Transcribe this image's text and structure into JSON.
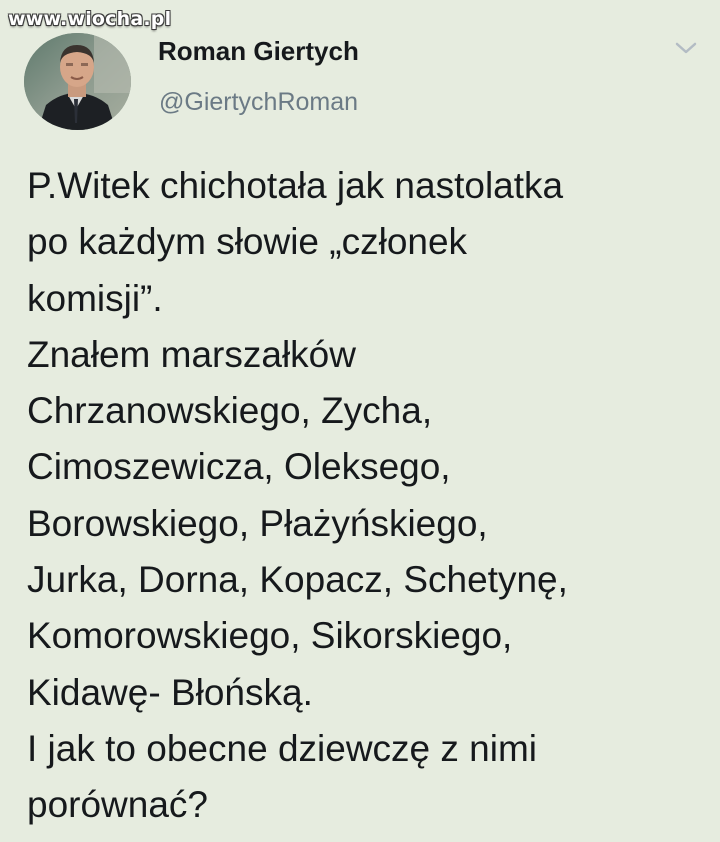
{
  "watermark": "www.wiocha.pl",
  "author": {
    "display_name": "Roman Giertych",
    "handle": "@GiertychRoman",
    "avatar_icon": "user-avatar-photo"
  },
  "menu_icon": "chevron-down-icon",
  "tweet": {
    "lines": [
      "P.Witek chichotała jak nastolatka",
      "po każdym słowie „członek",
      "komisji”.",
      "Znałem marszałków",
      "Chrzanowskiego, Zycha,",
      "Cimoszewicza, Oleksego,",
      "Borowskiego, Płażyńskiego,",
      "Jurka, Dorna, Kopacz, Schetynę,",
      "Komorowskiego, Sikorskiego,",
      "Kidawę- Błońską.",
      "I jak to obecne dziewczę z nimi",
      "porównać?"
    ]
  },
  "colors": {
    "background": "#e6ecdf",
    "text": "#16191c",
    "secondary_text": "#6b7a85"
  }
}
